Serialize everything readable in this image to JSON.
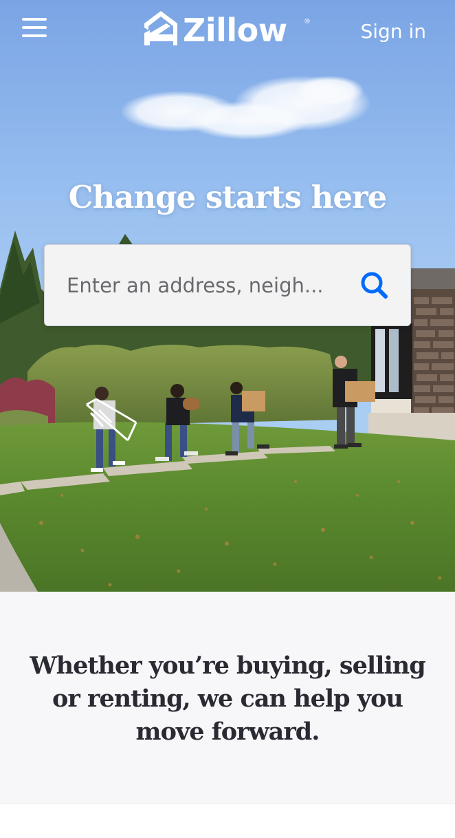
{
  "header": {
    "menu_icon": "hamburger-menu-icon",
    "logo_text": "Zillow",
    "logo_icon": "zillow-house-logo-icon",
    "logo_registered": "®",
    "sign_in_label": "Sign in"
  },
  "hero": {
    "headline": "Change starts here",
    "search": {
      "placeholder": "Enter an address, neigh...",
      "value": "",
      "icon": "search-icon"
    },
    "image": "family-moving-into-house-photo"
  },
  "tagline": {
    "text": "Whether you’re buying, selling or renting, we can help you move forward."
  },
  "colors": {
    "brand_blue": "#006aff",
    "sky": "#9cc2f1",
    "text_dark": "#2a2a33",
    "section_bg": "#f7f7f9"
  }
}
